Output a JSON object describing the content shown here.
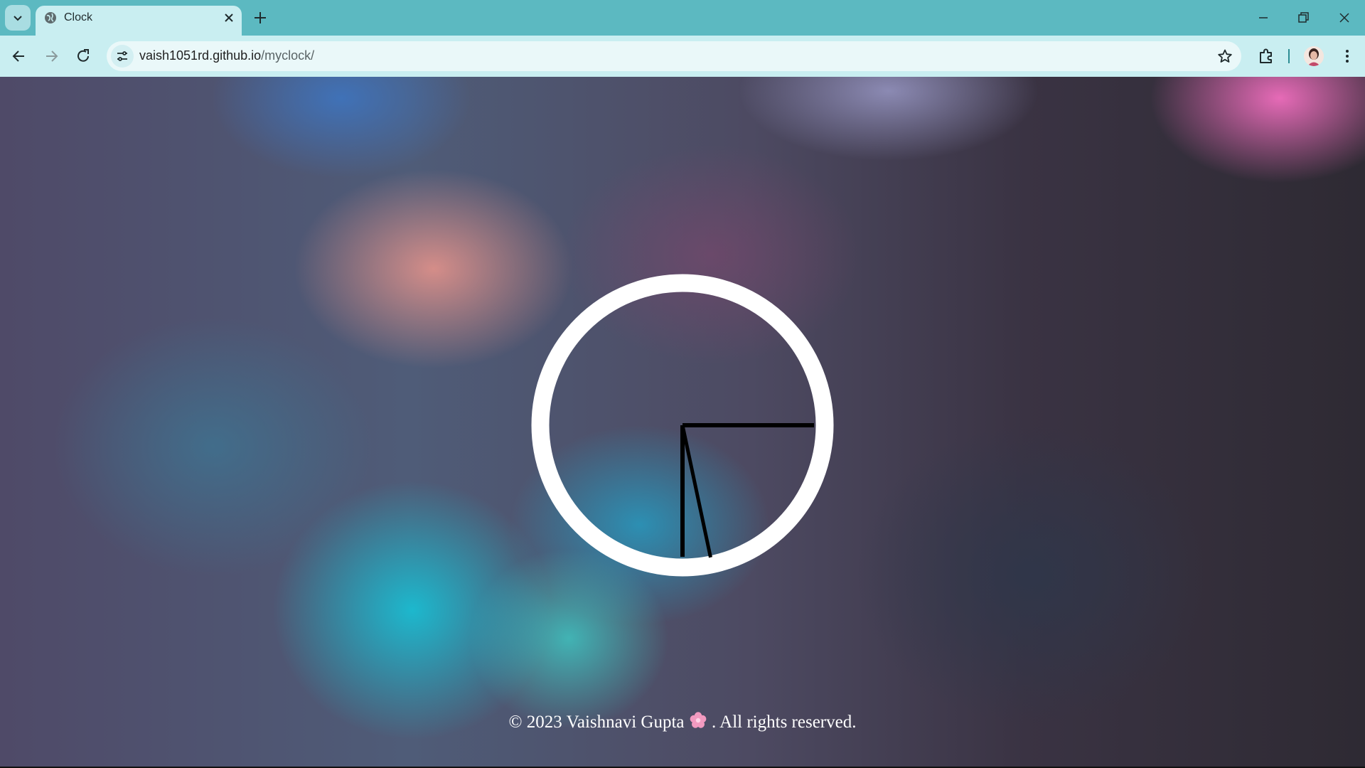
{
  "browser": {
    "tab": {
      "title": "Clock",
      "favicon": "globe-icon"
    },
    "address": {
      "domain": "vaish1051rd.github.io",
      "path": "/myclock/"
    },
    "icons": {
      "tab_search": "chevron-down-icon",
      "close_tab": "close-icon",
      "new_tab": "plus-icon",
      "minimize": "minimize-icon",
      "restore": "restore-icon",
      "close_window": "close-icon",
      "back": "arrow-left-icon",
      "forward": "arrow-right-icon",
      "reload": "reload-icon",
      "site_info": "tune-icon",
      "bookmark": "star-icon",
      "extensions": "puzzle-icon",
      "profile": "avatar",
      "menu": "kebab-icon"
    },
    "colors": {
      "tabbar": "#5cb9c1",
      "toolbar": "#c9eef1",
      "omnibox": "#eaf8f9"
    }
  },
  "page": {
    "clock": {
      "face_color": "#ffffff",
      "hand_color": "#000000",
      "hour": 3,
      "minute": 30,
      "second": 28
    },
    "footer": {
      "prefix": "© 2023 Vaishnavi Gupta",
      "emoji_icon": "flower-icon",
      "suffix": ". All rights reserved."
    }
  }
}
